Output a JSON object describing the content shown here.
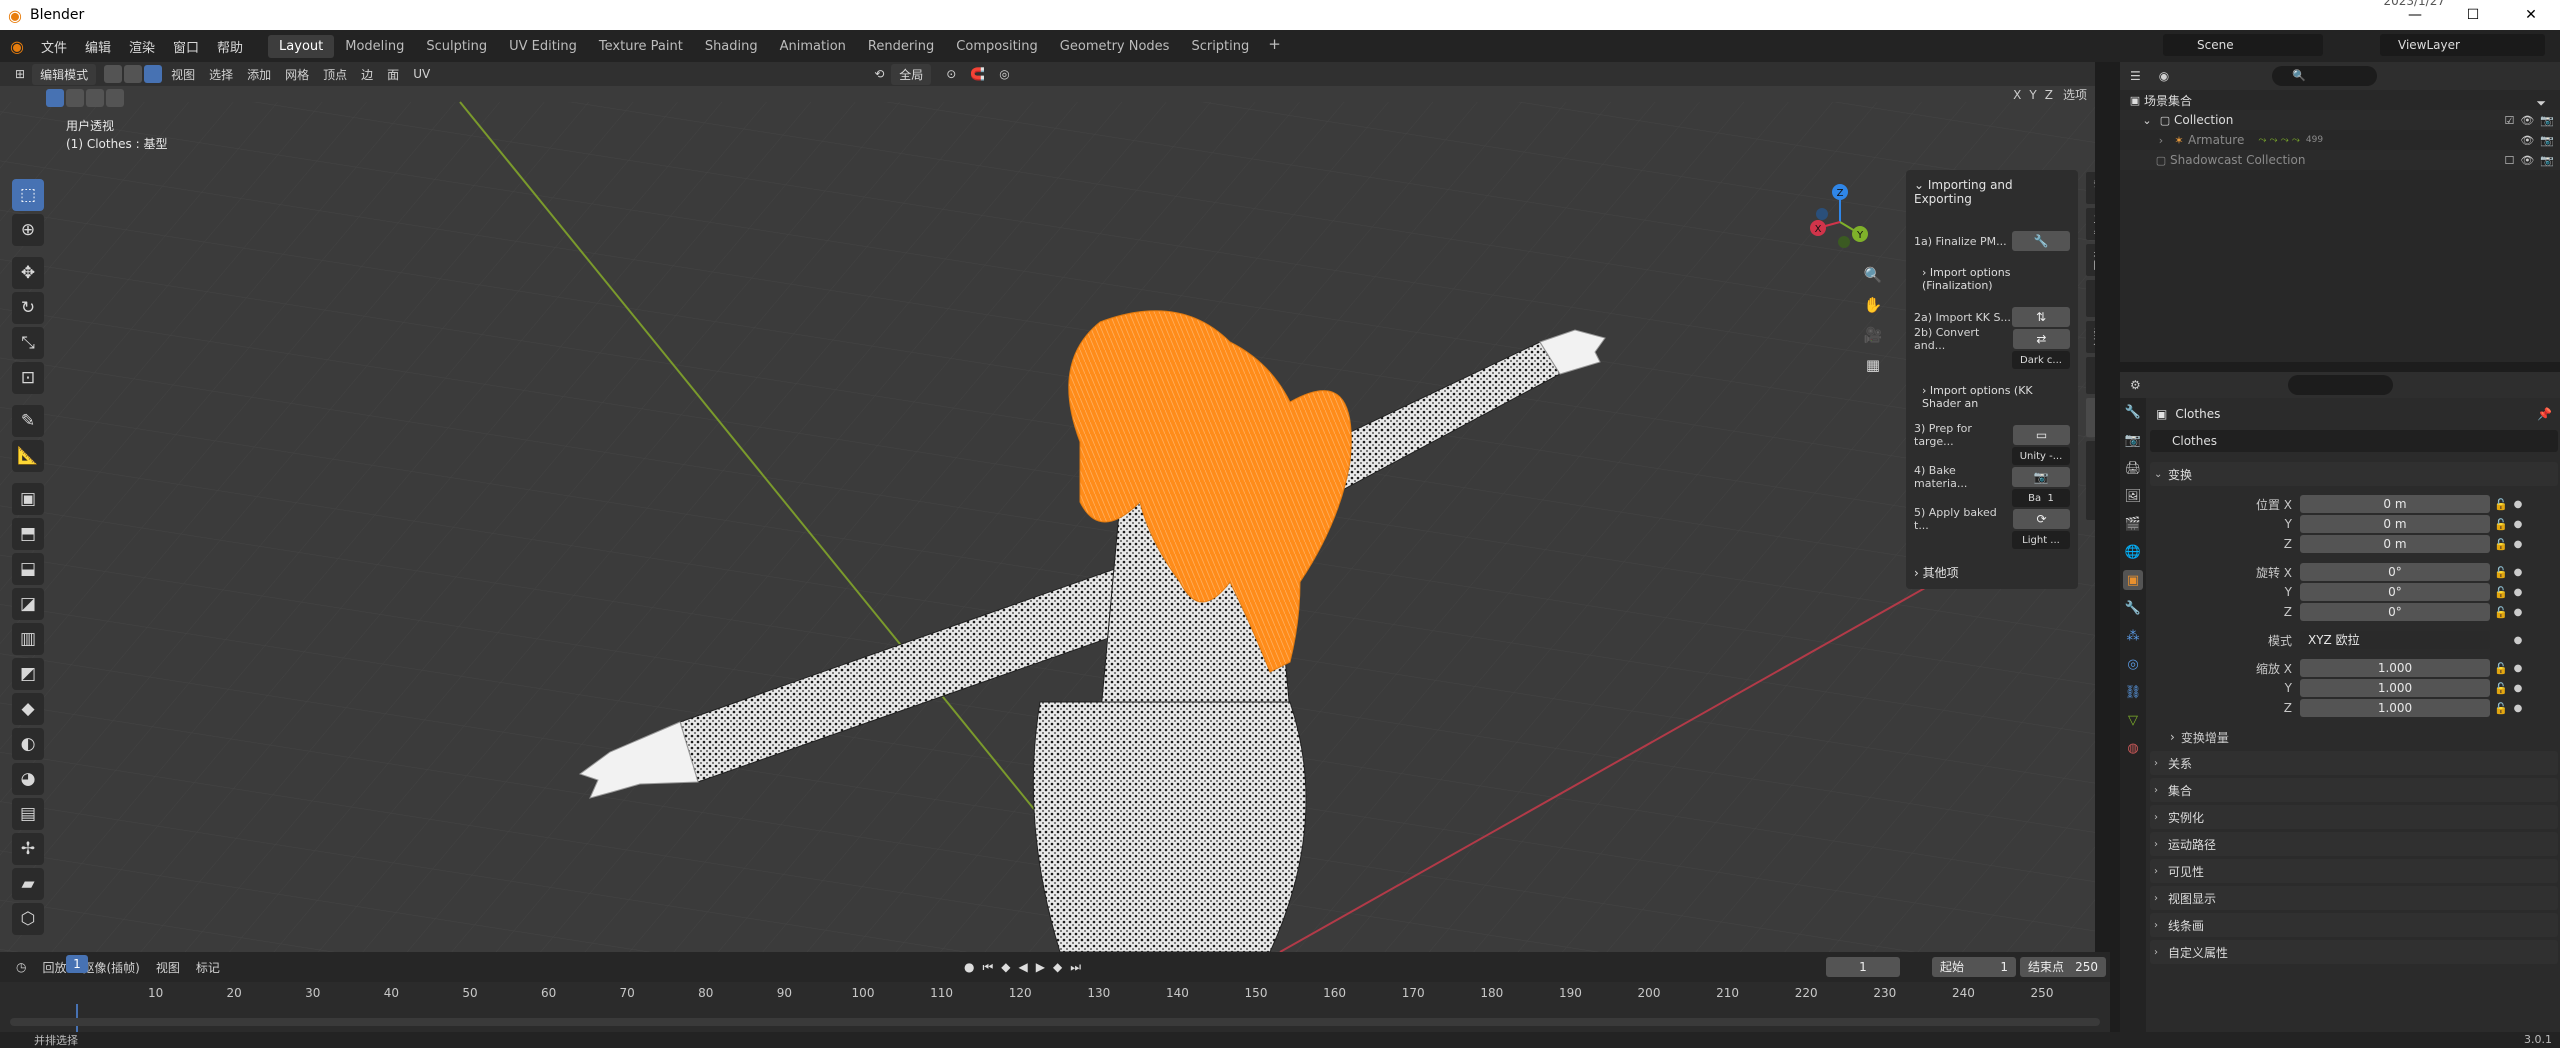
{
  "titlebar": {
    "app": "Blender",
    "date": "2023/1/27",
    "min": "—",
    "max": "☐",
    "close": "✕"
  },
  "menubar": {
    "items": [
      "文件",
      "编辑",
      "渲染",
      "窗口",
      "帮助"
    ],
    "tabs": [
      "Layout",
      "Modeling",
      "Sculpting",
      "UV Editing",
      "Texture Paint",
      "Shading",
      "Animation",
      "Rendering",
      "Compositing",
      "Geometry Nodes",
      "Scripting"
    ],
    "add_tab": "+",
    "scene": "Scene",
    "view_layer": "ViewLayer"
  },
  "viewport": {
    "mode": "编辑模式",
    "menus": [
      "视图",
      "选择",
      "添加",
      "网格",
      "顶点",
      "边",
      "面",
      "UV"
    ],
    "transform_orientation": "全局",
    "axes": [
      "X",
      "Y",
      "Z"
    ],
    "options_label": "选项",
    "overlay_line1": "用户透视",
    "overlay_line2": "(1) Clothes : 基型"
  },
  "gizmo": {
    "x": "X",
    "y": "Y",
    "z": "Z"
  },
  "npanel": {
    "header": "Importing and Exporting",
    "rows": [
      {
        "label": "1a) Finalize PM...",
        "button_icon": "wrench"
      },
      {
        "label": "2a) Import KK S...",
        "button_icon": "import"
      },
      {
        "label": "2b) Convert and...",
        "button_icon": "convert",
        "dropdown": "Dark c..."
      },
      {
        "label": "3) Prep for targe...",
        "button_icon": "box",
        "dropdown": "Unity -..."
      },
      {
        "label": "4) Bake materia...",
        "button_icon": "camera",
        "dropdown_a": "Ba",
        "dropdown_b": "1"
      },
      {
        "label": "5) Apply baked t...",
        "button_icon": "refresh",
        "dropdown": "Light ..."
      }
    ],
    "opt1": "Import options (Finalization)",
    "opt2": "Import options (KK Shader an",
    "other": "其他项"
  },
  "vtabs": [
    "条目",
    "工具",
    "视图",
    "MMD",
    "杂项",
    "CATS",
    "KKBP",
    "MatCombiner"
  ],
  "timeline": {
    "menus": [
      "回放",
      "抠像(插帧)",
      "视图",
      "标记"
    ],
    "current_frame": "1",
    "start_label": "起始",
    "start": "1",
    "end_label": "结束点",
    "end": "250",
    "ruler": [
      "10",
      "20",
      "30",
      "40",
      "50",
      "60",
      "70",
      "80",
      "90",
      "100",
      "110",
      "120",
      "130",
      "140",
      "150",
      "160",
      "170",
      "180",
      "190",
      "200",
      "210",
      "220",
      "230",
      "240",
      "250"
    ],
    "cursor": "1"
  },
  "statusbar": {
    "hint": "并排选择",
    "version": "3.0.1"
  },
  "outliner": {
    "scene_collection": "场景集合",
    "items": [
      {
        "name": "Collection"
      },
      {
        "name": "Armature",
        "badge": "499"
      },
      {
        "name": "Shadowcast Collection"
      }
    ]
  },
  "properties": {
    "object": "Clothes",
    "object_field": "Clothes",
    "transform": "变换",
    "location_label": "位置 X",
    "location": [
      "0 m",
      "0 m",
      "0 m"
    ],
    "rotation_label": "旋转 X",
    "rotation": [
      "0°",
      "0°",
      "0°"
    ],
    "mode_label": "模式",
    "mode_value": "XYZ 欧拉",
    "scale_label": "缩放 X",
    "scale": [
      "1.000",
      "1.000",
      "1.000"
    ],
    "y": "Y",
    "z": "Z",
    "delta": "变换增量",
    "sections": [
      "关系",
      "集合",
      "实例化",
      "运动路径",
      "可见性",
      "视图显示",
      "线条画",
      "自定义属性"
    ]
  },
  "colors": {
    "accent": "#4772b3",
    "hair": "#ff8c1a",
    "x_axis": "#d0344a",
    "y_axis": "#7fb12a",
    "z_axis": "#2f86e8"
  }
}
